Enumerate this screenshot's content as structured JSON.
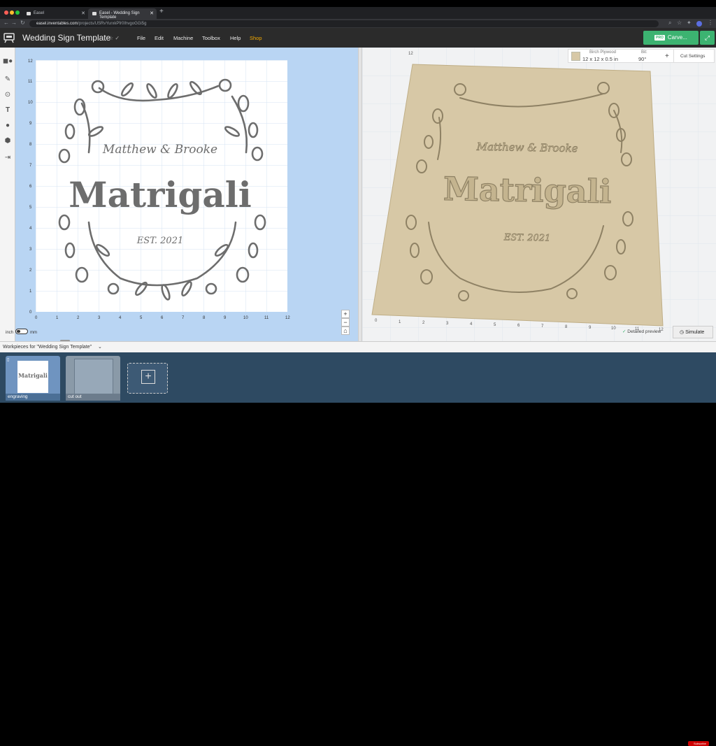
{
  "browser": {
    "tabs": [
      {
        "label": "Easel"
      },
      {
        "label": "Easel - Wedding Sign Template"
      }
    ],
    "url_host": "easel.inventables.com",
    "url_path": "/projects/USRvYurxkPfr0IhvgoGGi5g"
  },
  "header": {
    "title": "Wedding Sign Template",
    "menu": [
      "File",
      "Edit",
      "Machine",
      "Toolbox",
      "Help",
      "Shop"
    ],
    "pro_badge": "PRO",
    "carve_label": "Carve..."
  },
  "material": {
    "name": "Birch Plywood",
    "size": "12 x 12 x 0.5 in",
    "bit_label": "Bit:",
    "bit_value": "90°",
    "cut_settings": "Cut Settings"
  },
  "design": {
    "names": "Matthew & Brooke",
    "surname": "Matrigali",
    "est": "EST. 2021"
  },
  "axis_ticks": [
    "0",
    "1",
    "2",
    "3",
    "4",
    "5",
    "6",
    "7",
    "8",
    "9",
    "10",
    "11",
    "12"
  ],
  "units": {
    "inch": "inch",
    "mm": "mm"
  },
  "preview": {
    "detailed": "Detailed preview",
    "simulate": "Simulate"
  },
  "workpieces": {
    "label": "Workpieces for \"Wedding Sign Template\"",
    "items": [
      {
        "label": "engraving"
      },
      {
        "label": "cut out"
      }
    ]
  },
  "youtube_badge": "Subscribe",
  "colors": {
    "carve": "#3cb371",
    "canvas_bg": "#b9d5f3",
    "tray": "#2e4a62",
    "wood": "#d7c8a6",
    "design_gray": "#6d6d6d",
    "shop": "#f2a900"
  }
}
